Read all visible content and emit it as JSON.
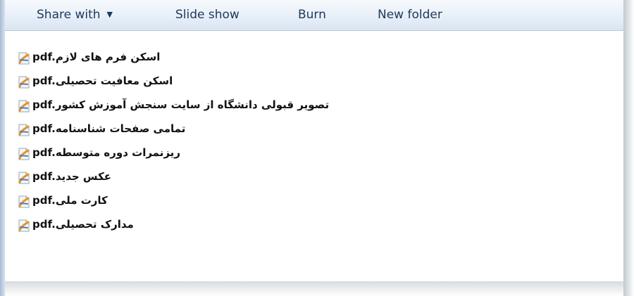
{
  "toolbar": {
    "share_label": "Share with",
    "share_caret": "▼",
    "slideshow_label": "Slide show",
    "burn_label": "Burn",
    "new_folder_label": "New folder"
  },
  "files": [
    {
      "name": "pdf.اسکن فرم های لازم",
      "icon": "pdf-file-icon"
    },
    {
      "name": "pdf.اسکن معافیت تحصیلی",
      "icon": "pdf-file-icon"
    },
    {
      "name": "pdf.تصویر قبولی دانشگاه از سایت سنجش آموزش کشور",
      "icon": "pdf-file-icon"
    },
    {
      "name": "pdf.تمامی صفحات شناسنامه",
      "icon": "pdf-file-icon"
    },
    {
      "name": "pdf.ریزنمرات دوره متوسطه",
      "icon": "pdf-file-icon"
    },
    {
      "name": "pdf.عکس جدید",
      "icon": "pdf-file-icon"
    },
    {
      "name": "pdf.کارت ملی",
      "icon": "pdf-file-icon"
    },
    {
      "name": "pdf.مدارک تحصیلی",
      "icon": "pdf-file-icon"
    }
  ],
  "colors": {
    "toolbar_text": "#1e395b",
    "file_text": "#111111",
    "icon_orange": "#e8902a",
    "icon_blue": "#4a7fc1"
  }
}
